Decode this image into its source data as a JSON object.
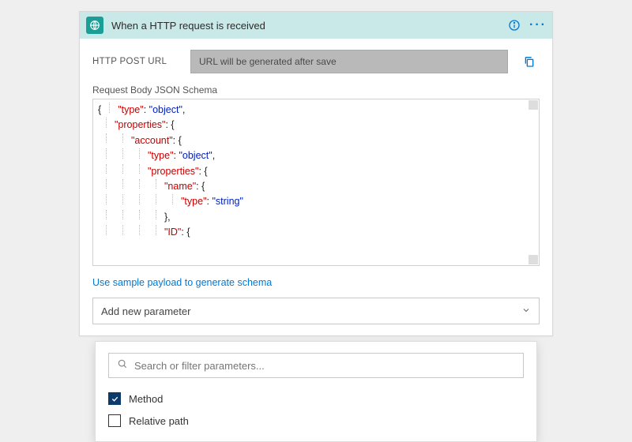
{
  "header": {
    "title": "When a HTTP request is received",
    "icon_name": "globe-request-icon"
  },
  "url_row": {
    "label": "HTTP POST URL",
    "value": "URL will be generated after save"
  },
  "schema": {
    "label": "Request Body JSON Schema",
    "tokens": [
      [
        "{",
        "p",
        0
      ],
      [
        "\"type\"",
        "k",
        1
      ],
      [
        ": ",
        "p",
        -1
      ],
      [
        "\"object\"",
        "s",
        -1
      ],
      [
        ",",
        "p",
        -1
      ],
      [
        "\n",
        "n",
        -1
      ],
      [
        "\"properties\"",
        "k",
        1
      ],
      [
        ": {",
        "p",
        -1
      ],
      [
        "\n",
        "n",
        -1
      ],
      [
        "\"account\"",
        "k",
        2
      ],
      [
        ": {",
        "p",
        -1
      ],
      [
        "\n",
        "n",
        -1
      ],
      [
        "\"type\"",
        "k",
        3
      ],
      [
        ": ",
        "p",
        -1
      ],
      [
        "\"object\"",
        "s",
        -1
      ],
      [
        ",",
        "p",
        -1
      ],
      [
        "\n",
        "n",
        -1
      ],
      [
        "\"properties\"",
        "k",
        3
      ],
      [
        ": {",
        "p",
        -1
      ],
      [
        "\n",
        "n",
        -1
      ],
      [
        "\"name\"",
        "k",
        4
      ],
      [
        ": {",
        "p",
        -1
      ],
      [
        "\n",
        "n",
        -1
      ],
      [
        "\"type\"",
        "k",
        5
      ],
      [
        ": ",
        "p",
        -1
      ],
      [
        "\"string\"",
        "s",
        -1
      ],
      [
        "\n",
        "n",
        -1
      ],
      [
        "},",
        "p",
        4
      ],
      [
        "\n",
        "n",
        -1
      ],
      [
        "\"ID\"",
        "k",
        4
      ],
      [
        ": {",
        "p",
        -1
      ]
    ]
  },
  "links": {
    "sample_payload": "Use sample payload to generate schema"
  },
  "param_dropdown": {
    "label": "Add new parameter"
  },
  "dropdown": {
    "search_placeholder": "Search or filter parameters...",
    "items": [
      {
        "label": "Method",
        "checked": true
      },
      {
        "label": "Relative path",
        "checked": false
      }
    ]
  }
}
